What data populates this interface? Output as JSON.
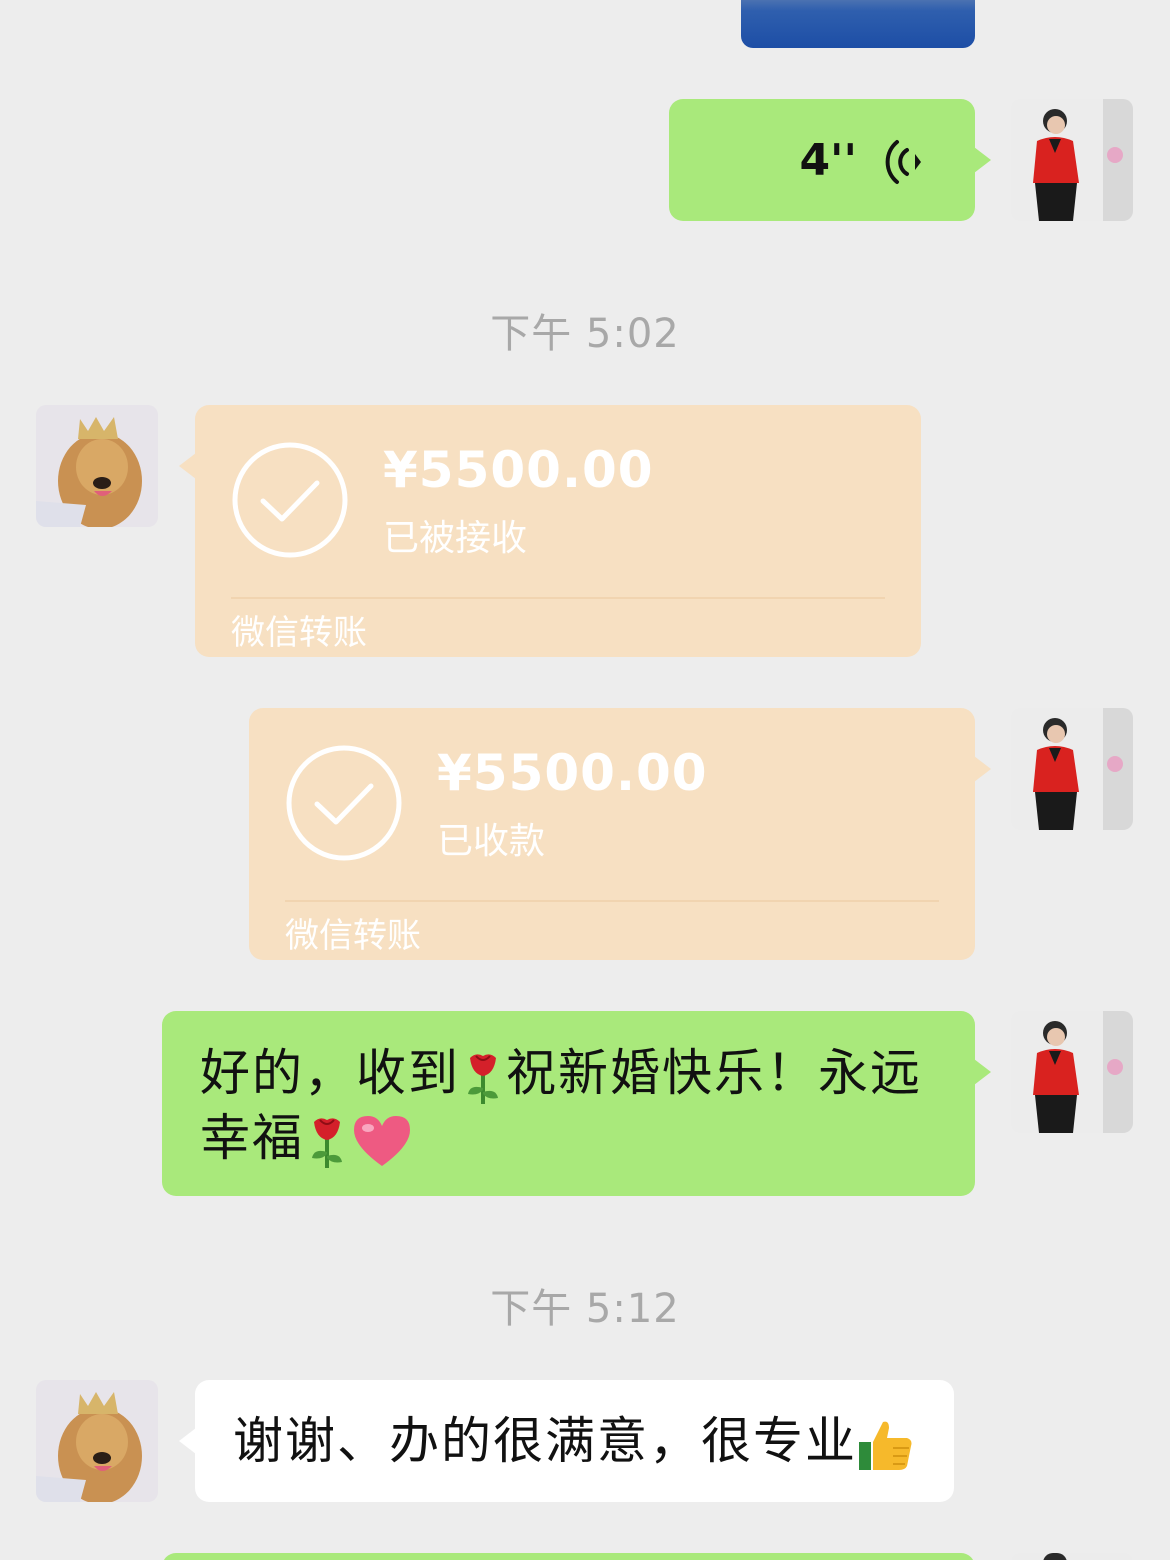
{
  "messages": {
    "voice": {
      "duration": "4''"
    },
    "time_1": "下午 5:02",
    "transfer_received": {
      "amount": "¥5500.00",
      "status": "已被接收",
      "label": "微信转账"
    },
    "transfer_collected": {
      "amount": "¥5500.00",
      "status": "已收款",
      "label": "微信转账"
    },
    "reply": {
      "part1": "好的，收到",
      "part2": "祝新婚快乐！永远",
      "part3": "幸福"
    },
    "time_2": "下午 5:12",
    "thanks": {
      "text": "谢谢、办的很满意，很专业"
    }
  },
  "colors": {
    "background": "#ededed",
    "green_bubble": "#a9e97b",
    "white_bubble": "#ffffff",
    "transfer_bubble": "#f7e0c2",
    "timestamp": "#a8a8a8"
  },
  "icons": {
    "voice": "voice-wave-icon",
    "check": "check-circle-icon",
    "rose": "rose-emoji",
    "heart": "heart-emoji",
    "thumbs_up": "thumbs-up-emoji"
  }
}
